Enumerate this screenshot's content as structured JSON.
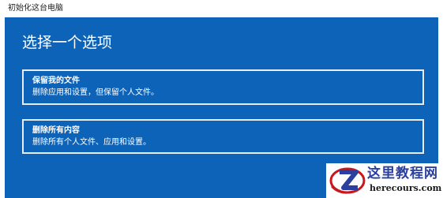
{
  "window": {
    "title": "初始化这台电脑"
  },
  "panel": {
    "heading": "选择一个选项",
    "options": [
      {
        "title": "保留我的文件",
        "description": "删除应用和设置，但保留个人文件。"
      },
      {
        "title": "删除所有内容",
        "description": "删除所有个人文件、应用和设置。"
      }
    ]
  },
  "watermark": {
    "name": "这里教程网",
    "url": "herecours.com"
  },
  "colors": {
    "panel_bg": "#0d63b8",
    "option_border": "#e8eef7",
    "watermark_text": "#2a3f9e",
    "logo_red": "#c8181e"
  }
}
